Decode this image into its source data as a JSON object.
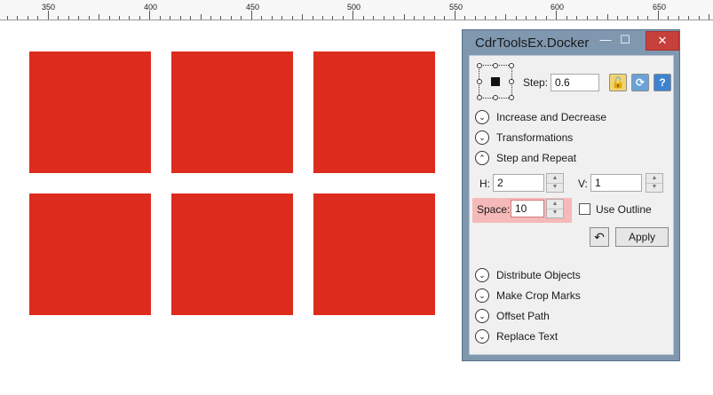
{
  "ruler": {
    "labels": [
      "350",
      "400",
      "450",
      "500",
      "550",
      "600",
      "650"
    ]
  },
  "canvas": {
    "shape_color": "#dd2c1d",
    "shapes": [
      {
        "name": "red-square"
      },
      {
        "name": "red-square"
      },
      {
        "name": "red-square"
      },
      {
        "name": "red-square"
      },
      {
        "name": "red-square"
      },
      {
        "name": "red-square"
      }
    ]
  },
  "docker": {
    "title": "CdrToolsEx.Docker",
    "window_buttons": {
      "minimize": "—",
      "maximize": "☐",
      "close": "✕"
    },
    "step": {
      "label": "Step:",
      "value": "0.6"
    },
    "tools": {
      "lock": "🔓",
      "refresh": "⟳",
      "help": "?"
    },
    "sections_top": [
      {
        "label": "Increase and Decrease",
        "chevron": "⌄"
      },
      {
        "label": "Transformations",
        "chevron": "⌄"
      },
      {
        "label": "Step and Repeat",
        "chevron": "⌃"
      }
    ],
    "h": {
      "label": "H:",
      "value": "2"
    },
    "v": {
      "label": "V:",
      "value": "1"
    },
    "space": {
      "label": "Space:",
      "value": "10"
    },
    "use_outline": {
      "label": "Use Outline",
      "checked": false
    },
    "undo_icon": "↶",
    "apply_label": "Apply",
    "sections_bottom": [
      {
        "label": "Distribute Objects",
        "chevron": "⌄"
      },
      {
        "label": "Make Crop Marks",
        "chevron": "⌄"
      },
      {
        "label": "Offset Path",
        "chevron": "⌄"
      },
      {
        "label": "Replace Text",
        "chevron": "⌄"
      }
    ],
    "highlight_color": "#f6b9b9"
  }
}
